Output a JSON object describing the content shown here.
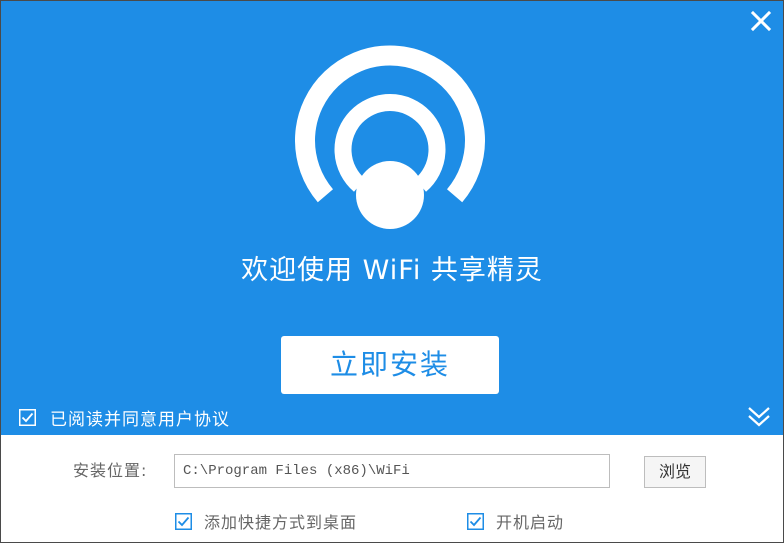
{
  "app": {
    "title": "欢迎使用 WiFi 共享精灵",
    "install_label": "立即安装",
    "accent_color": "#1e8de6"
  },
  "header": {
    "close_icon": "close-icon",
    "expand_icon": "double-chevron-down-icon"
  },
  "logo": {
    "icon": "wifi-signal-icon"
  },
  "agreement": {
    "checked": true,
    "label": "已阅读并同意用户协议"
  },
  "install_location": {
    "label": "安装位置:",
    "path_value": "C:\\Program Files (x86)\\WiFi",
    "browse_label": "浏览"
  },
  "options": {
    "shortcut": {
      "checked": true,
      "label": "添加快捷方式到桌面"
    },
    "startup": {
      "checked": true,
      "label": "开机启动"
    }
  }
}
